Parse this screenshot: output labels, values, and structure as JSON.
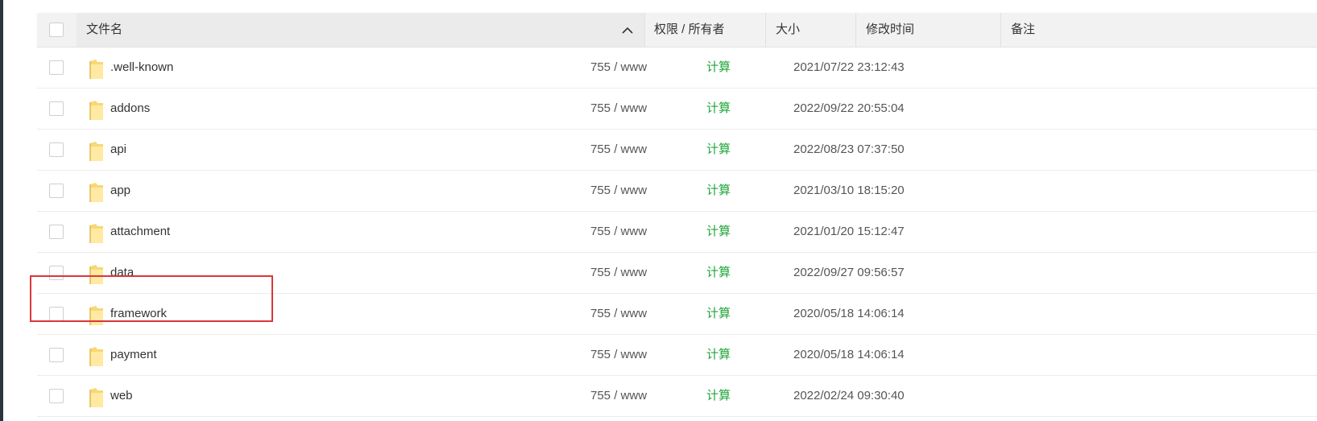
{
  "header": {
    "name_label": "文件名",
    "perm_label": "权限 / 所有者",
    "size_label": "大小",
    "time_label": "修改时间",
    "note_label": "备注"
  },
  "rows": [
    {
      "name": ".well-known",
      "perm": "755 / www",
      "size": "计算",
      "time": "2021/07/22 23:12:43"
    },
    {
      "name": "addons",
      "perm": "755 / www",
      "size": "计算",
      "time": "2022/09/22 20:55:04"
    },
    {
      "name": "api",
      "perm": "755 / www",
      "size": "计算",
      "time": "2022/08/23 07:37:50"
    },
    {
      "name": "app",
      "perm": "755 / www",
      "size": "计算",
      "time": "2021/03/10 18:15:20"
    },
    {
      "name": "attachment",
      "perm": "755 / www",
      "size": "计算",
      "time": "2021/01/20 15:12:47"
    },
    {
      "name": "data",
      "perm": "755 / www",
      "size": "计算",
      "time": "2022/09/27 09:56:57"
    },
    {
      "name": "framework",
      "perm": "755 / www",
      "size": "计算",
      "time": "2020/05/18 14:06:14"
    },
    {
      "name": "payment",
      "perm": "755 / www",
      "size": "计算",
      "time": "2020/05/18 14:06:14"
    },
    {
      "name": "web",
      "perm": "755 / www",
      "size": "计算",
      "time": "2022/02/24 09:30:40"
    }
  ],
  "colors": {
    "size_link": "#20a53a",
    "highlight": "#d9373a",
    "folder": "#f8d775"
  },
  "icons": {
    "row": "folder-icon",
    "sort": "chevron-up-icon"
  }
}
